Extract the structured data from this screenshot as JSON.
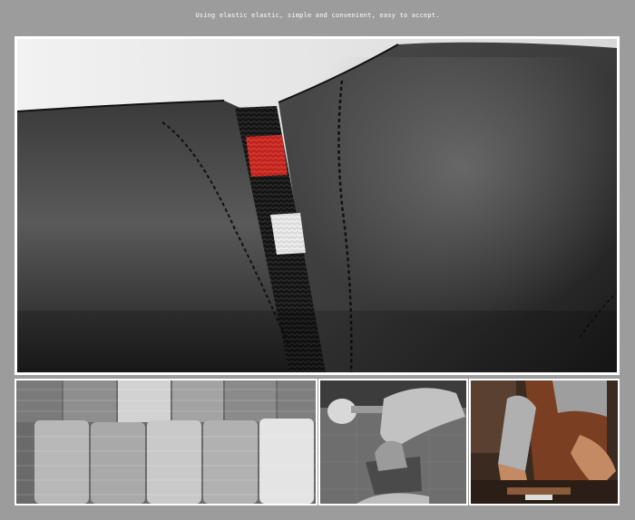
{
  "header": {
    "caption": "Using elastic elastic, simple and convenient, easy to accept."
  },
  "images": {
    "hero": "close-up of black leather shoe with elastic gore stripe",
    "thumb1": "rolls of grey and white elastic bands",
    "thumb2": "hands cutting leather with a tool and mallet",
    "thumb3": "craftsman in apron working at leather bench"
  },
  "colors": {
    "background": "#9c9c9c",
    "leather": "#2b2b2b",
    "elastic_red": "#c0241e",
    "frame": "#ffffff"
  }
}
